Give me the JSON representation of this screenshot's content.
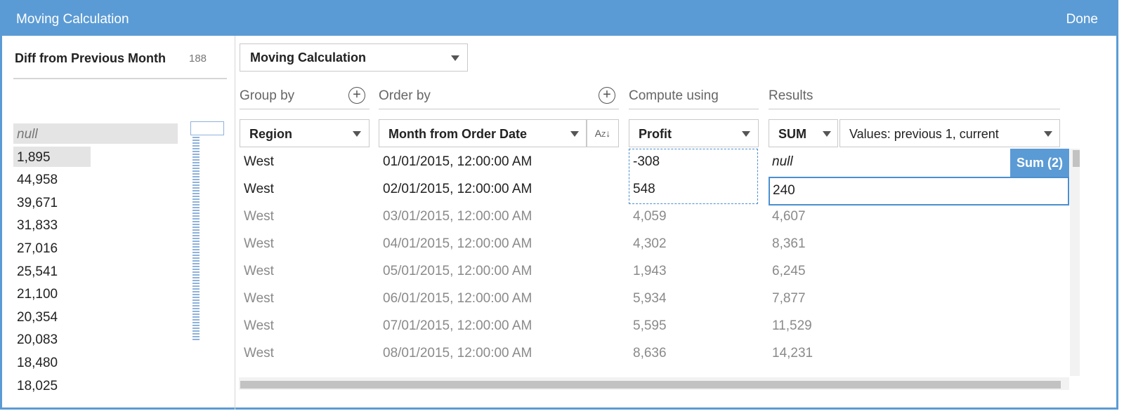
{
  "dialog": {
    "title": "Moving Calculation",
    "done_label": "Done"
  },
  "field": {
    "name": "Diff from Previous Month",
    "count": "188"
  },
  "histogram": [
    {
      "label": "null",
      "fraction": 1.0,
      "is_null": true
    },
    {
      "label": "1,895",
      "fraction": 0.47
    },
    {
      "label": "44,958",
      "fraction": 0.0
    },
    {
      "label": "39,671",
      "fraction": 0.0
    },
    {
      "label": "31,833",
      "fraction": 0.0
    },
    {
      "label": "27,016",
      "fraction": 0.0
    },
    {
      "label": "25,541",
      "fraction": 0.0
    },
    {
      "label": "21,100",
      "fraction": 0.0
    },
    {
      "label": "20,354",
      "fraction": 0.0
    },
    {
      "label": "20,083",
      "fraction": 0.0
    },
    {
      "label": "18,480",
      "fraction": 0.0
    },
    {
      "label": "18,025",
      "fraction": 0.0
    }
  ],
  "calc_type": {
    "selected": "Moving Calculation"
  },
  "sections": {
    "group_by": "Group by",
    "order_by": "Order by",
    "compute_using": "Compute using",
    "results": "Results"
  },
  "selectors": {
    "group_by": "Region",
    "order_by": "Month from Order Date",
    "sort_icon": "A-Z ascending sort",
    "compute_using": "Profit",
    "aggregation": "SUM",
    "window": "Values: previous 1, current"
  },
  "rows": [
    {
      "region": "West",
      "date": "01/01/2015, 12:00:00 AM",
      "profit": "-308",
      "result": "null",
      "highlighted": true
    },
    {
      "region": "West",
      "date": "02/01/2015, 12:00:00 AM",
      "profit": "548",
      "result": "240",
      "highlighted": true
    },
    {
      "region": "West",
      "date": "03/01/2015, 12:00:00 AM",
      "profit": "4,059",
      "result": "4,607"
    },
    {
      "region": "West",
      "date": "04/01/2015, 12:00:00 AM",
      "profit": "4,302",
      "result": "8,361"
    },
    {
      "region": "West",
      "date": "05/01/2015, 12:00:00 AM",
      "profit": "1,943",
      "result": "6,245"
    },
    {
      "region": "West",
      "date": "06/01/2015, 12:00:00 AM",
      "profit": "5,934",
      "result": "7,877"
    },
    {
      "region": "West",
      "date": "07/01/2015, 12:00:00 AM",
      "profit": "5,595",
      "result": "11,529"
    },
    {
      "region": "West",
      "date": "08/01/2015, 12:00:00 AM",
      "profit": "8,636",
      "result": "14,231"
    }
  ],
  "tooltip": {
    "label": "Sum (2)"
  },
  "colors": {
    "accent": "#5b9bd5",
    "selection": "#4a8fd0"
  }
}
